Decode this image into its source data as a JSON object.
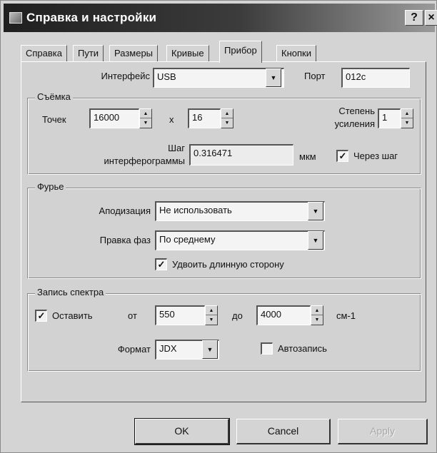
{
  "window": {
    "title": "Справка и настройки",
    "help_glyph": "?",
    "close_glyph": "×"
  },
  "tabs": [
    {
      "label": "Справка"
    },
    {
      "label": "Пути"
    },
    {
      "label": "Размеры"
    },
    {
      "label": "Кривые"
    },
    {
      "label": "Прибор",
      "active": true
    },
    {
      "label": "Кнопки"
    }
  ],
  "device": {
    "interface_label": "Интерфейс",
    "interface_value": "USB",
    "port_label": "Порт",
    "port_value": "012c"
  },
  "capture": {
    "group_title": "Съёмка",
    "points_label": "Точек",
    "points_value": "16000",
    "times_sign": "x",
    "multiplier_value": "16",
    "gain_label_line1": "Степень",
    "gain_label_line2": "усиления",
    "gain_value": "1",
    "step_label_line1": "Шаг",
    "step_label_line2": "интерферограммы",
    "step_value": "0.316471",
    "step_unit": "мкм",
    "through_step_label": "Через шаг",
    "through_step_checked": true
  },
  "fourier": {
    "group_title": "Фурье",
    "apodization_label": "Аподизация",
    "apodization_value": "Не использовать",
    "phase_label": "Правка фаз",
    "phase_value": "По среднему",
    "double_label": "Удвоить длинную сторону",
    "double_checked": true
  },
  "spectrum": {
    "group_title": "Запись спектра",
    "keep_label": "Оставить",
    "keep_checked": true,
    "from_label": "от",
    "from_value": "550",
    "to_label": "до",
    "to_value": "4000",
    "unit": "см-1",
    "format_label": "Формат",
    "format_value": "JDX",
    "autosave_label": "Автозапись",
    "autosave_checked": false
  },
  "buttons": {
    "ok": "OK",
    "cancel": "Cancel",
    "apply": "Apply"
  },
  "icons": {
    "check": "✓",
    "spin_up": "▲",
    "spin_down": "▼",
    "dropdown": "▼"
  }
}
